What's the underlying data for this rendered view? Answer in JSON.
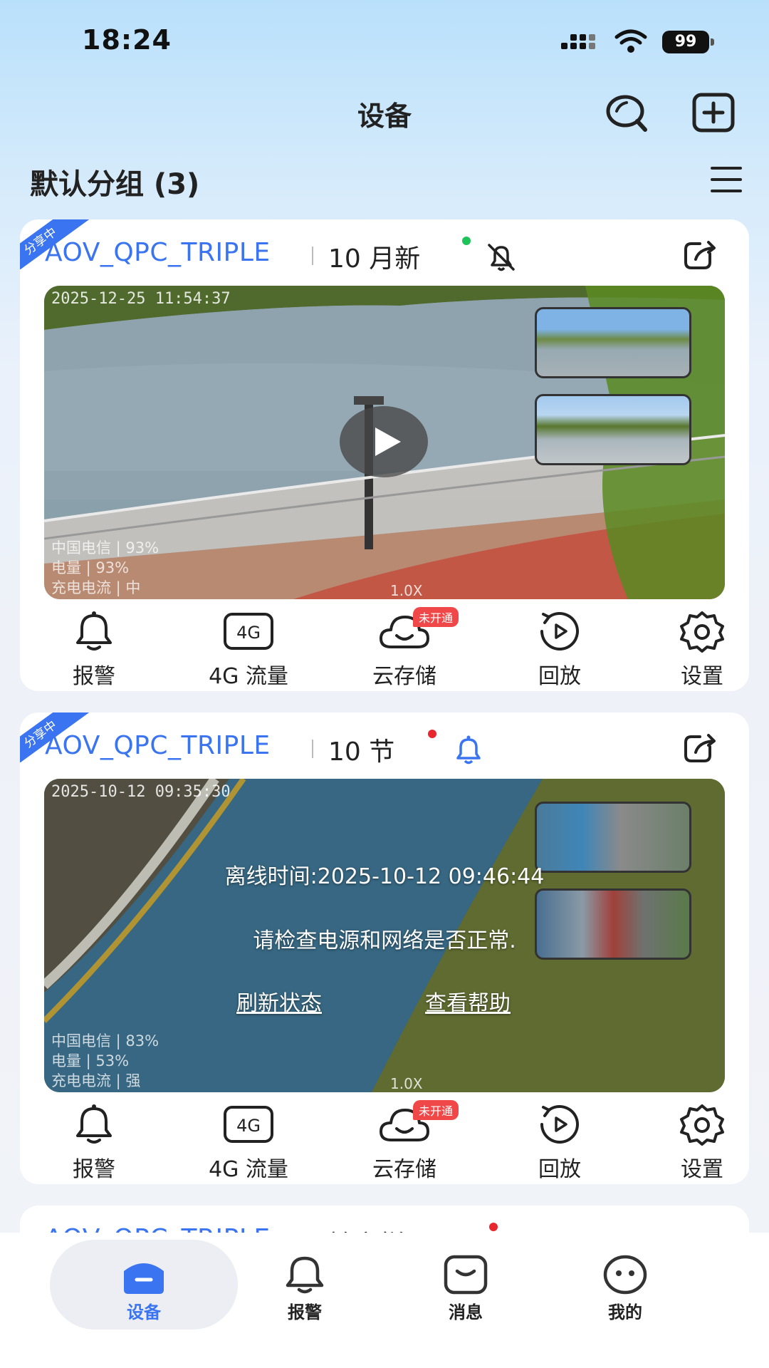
{
  "status_bar": {
    "time": "18:24",
    "battery": "99"
  },
  "header": {
    "title": "设备"
  },
  "group": {
    "title": "默认分组 (3)"
  },
  "cards": [
    {
      "share_tag": "分享中",
      "name": "AOV_QPC_TRIPLE",
      "location": "10 月新",
      "status_color": "#1ec45a",
      "osd_time": "2025-12-25 11:54:37",
      "osd_lines": [
        "中国电信 | 93%",
        "电量 | 93%",
        "充电电流 | 中"
      ],
      "zoom": "1.0X",
      "online": true
    },
    {
      "share_tag": "分享中",
      "name": "AOV_QPC_TRIPLE",
      "location": "10 节",
      "status_color": "#e8262e",
      "osd_time": "2025-10-12 09:35:30",
      "osd_lines": [
        "中国电信 | 83%",
        "电量 | 53%",
        "充电电流 | 强"
      ],
      "zoom": "1.0X",
      "online": false,
      "offline_time": "离线时间:2025-10-12 09:46:44",
      "offline_hint": "请检查电源和网络是否正常.",
      "refresh_label": "刷新状态",
      "help_label": "查看帮助"
    },
    {
      "name": "AOV_QPC_TRIPLE",
      "location": "椿言样品",
      "status_color": "#e8262e"
    }
  ],
  "actions": {
    "alarm": "报警",
    "traffic": "4G 流量",
    "traffic_icon": "4G",
    "cloud": "云存储",
    "cloud_badge": "未开通",
    "playback": "回放",
    "settings": "设置"
  },
  "nav": {
    "devices": "设备",
    "alarm": "报警",
    "messages": "消息",
    "mine": "我的"
  },
  "colors": {
    "accent": "#3a74f0"
  }
}
